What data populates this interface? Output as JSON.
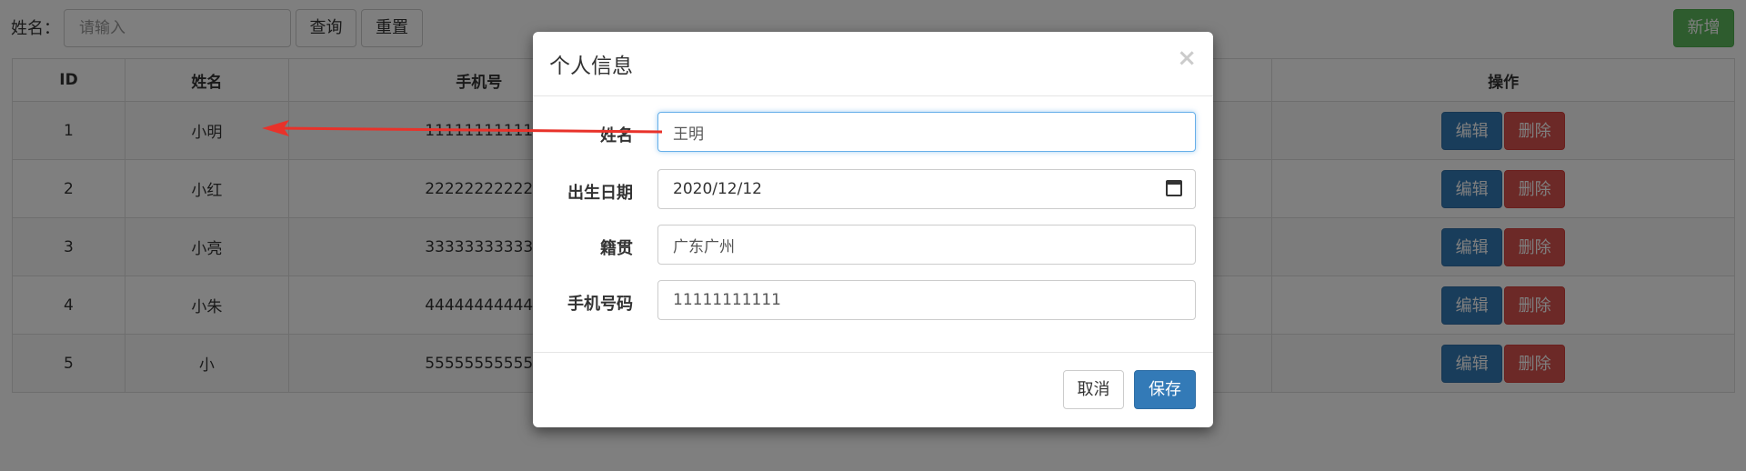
{
  "toolbar": {
    "search_label": "姓名：",
    "search_placeholder": "请输入",
    "query_label": "查询",
    "reset_label": "重置",
    "add_label": "新增"
  },
  "table": {
    "headers": [
      "ID",
      "姓名",
      "手机号",
      "操作"
    ],
    "edit_label": "编辑",
    "delete_label": "删除",
    "rows": [
      {
        "id": "1",
        "name": "小明",
        "phone": "11111111111"
      },
      {
        "id": "2",
        "name": "小红",
        "phone": "22222222222"
      },
      {
        "id": "3",
        "name": "小亮",
        "phone": "33333333333"
      },
      {
        "id": "4",
        "name": "小朱",
        "phone": "44444444444"
      },
      {
        "id": "5",
        "name": "小",
        "phone": "55555555555"
      }
    ]
  },
  "modal": {
    "title": "个人信息",
    "close_symbol": "×",
    "fields": {
      "name_label": "姓名",
      "name_value": "王明",
      "birth_label": "出生日期",
      "birth_value": "2020/12/12",
      "origin_label": "籍贯",
      "origin_value": "广东广州",
      "phone_label": "手机号码",
      "phone_value": "11111111111"
    },
    "cancel_label": "取消",
    "save_label": "保存"
  },
  "colors": {
    "primary": "#337ab7",
    "danger": "#d9534f",
    "success": "#5cb85c",
    "annotation_arrow": "#e8322a"
  }
}
